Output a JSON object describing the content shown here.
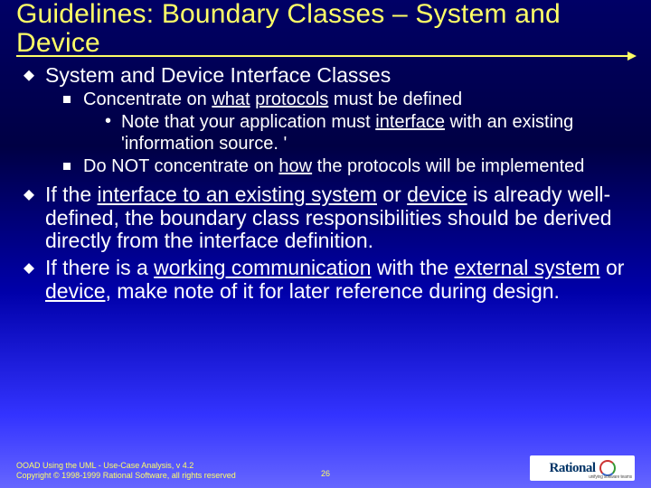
{
  "title": "Guidelines: Boundary Classes – System and Device",
  "bullets": {
    "b1": "System and Device Interface Classes",
    "b1_1_a": "Concentrate on ",
    "b1_1_u1": "what",
    "b1_1_sp": " ",
    "b1_1_u2": "protocols",
    "b1_1_b": " must be defined",
    "b1_1_1_a": "Note that your application must ",
    "b1_1_1_u": "interface",
    "b1_1_1_b": " with an existing 'information source. '",
    "b1_2_a": "Do NOT concentrate on ",
    "b1_2_u": "how",
    "b1_2_b": " the protocols will be implemented",
    "b2_a": "If the ",
    "b2_u1": "interface to an existing system",
    "b2_m1": " or ",
    "b2_u2": "device",
    "b2_b": " is already well-defined, the boundary class responsibilities should be derived directly from the interface definition.",
    "b3_a": "If there is a ",
    "b3_u1": "working communication",
    "b3_m1": " with the ",
    "b3_u2": "external system",
    "b3_m2": " or ",
    "b3_u3": "device",
    "b3_b": ", make note of it for later reference during design."
  },
  "footer": {
    "line1": "OOAD Using the UML - Use-Case Analysis, v 4.2",
    "line2": "Copyright © 1998-1999 Rational Software, all rights reserved",
    "page": "26",
    "logo_brand": "Rational",
    "logo_tag": "unifying software teams"
  }
}
